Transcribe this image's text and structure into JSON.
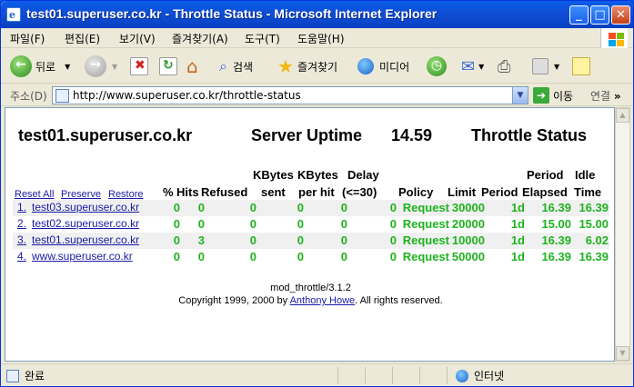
{
  "window": {
    "title": "test01.superuser.co.kr - Throttle Status - Microsoft Internet Explorer"
  },
  "menu": [
    "파일(F)",
    "편집(E)",
    "보기(V)",
    "즐겨찾기(A)",
    "도구(T)",
    "도움말(H)"
  ],
  "toolbar": {
    "back_label": "뒤로",
    "search_label": "검색",
    "favorites_label": "즐겨찾기",
    "media_label": "미디어"
  },
  "address": {
    "label": "주소(D)",
    "url": "http://www.superuser.co.kr/throttle-status",
    "go_label": "이동",
    "links_label": "연결"
  },
  "page": {
    "host": "test01.superuser.co.kr",
    "uptime_label": "Server Uptime",
    "uptime_value": "14.59",
    "status_title": "Throttle Status",
    "links": {
      "reset": "Reset All",
      "preserve": "Preserve",
      "restore": "Restore"
    },
    "headers": {
      "kbytes_sent_1": "KBytes",
      "kbytes_sent_2": "sent",
      "kbytes_per_hit_1": "KBytes",
      "kbytes_per_hit_2": "per hit",
      "delay_1": "Delay",
      "delay_2": "(<=30)",
      "period_elapsed_1": "Period",
      "period_elapsed_2": "Elapsed",
      "idle_1": "Idle",
      "idle_2": "Time",
      "pct": "%",
      "hits": "Hits",
      "refused": "Refused",
      "policy": "Policy",
      "limit": "Limit",
      "period": "Period"
    },
    "rows": [
      {
        "idx": "1.",
        "host": "test03.superuser.co.kr",
        "pct": "0",
        "hits": "0",
        "refused": "0",
        "sent": "0",
        "per_hit": "0",
        "delay": "0",
        "policy": "Request",
        "limit": "30000",
        "period": "1d",
        "elapsed": "16.39",
        "idle": "16.39"
      },
      {
        "idx": "2.",
        "host": "test02.superuser.co.kr",
        "pct": "0",
        "hits": "0",
        "refused": "0",
        "sent": "0",
        "per_hit": "0",
        "delay": "0",
        "policy": "Request",
        "limit": "20000",
        "period": "1d",
        "elapsed": "15.00",
        "idle": "15.00"
      },
      {
        "idx": "3.",
        "host": "test01.superuser.co.kr",
        "pct": "0",
        "hits": "3",
        "refused": "0",
        "sent": "0",
        "per_hit": "0",
        "delay": "0",
        "policy": "Request",
        "limit": "10000",
        "period": "1d",
        "elapsed": "16.39",
        "idle": "6.02"
      },
      {
        "idx": "4.",
        "host": "www.superuser.co.kr",
        "pct": "0",
        "hits": "0",
        "refused": "0",
        "sent": "0",
        "per_hit": "0",
        "delay": "0",
        "policy": "Request",
        "limit": "50000",
        "period": "1d",
        "elapsed": "16.39",
        "idle": "16.39"
      }
    ],
    "footer": {
      "version": "mod_throttle/3.1.2",
      "copyright_prefix": "Copyright 1999, 2000 by",
      "author": "Anthony Howe",
      "copyright_suffix": ". All rights reserved."
    }
  },
  "status": {
    "left": "완료",
    "zone": "인터넷"
  }
}
